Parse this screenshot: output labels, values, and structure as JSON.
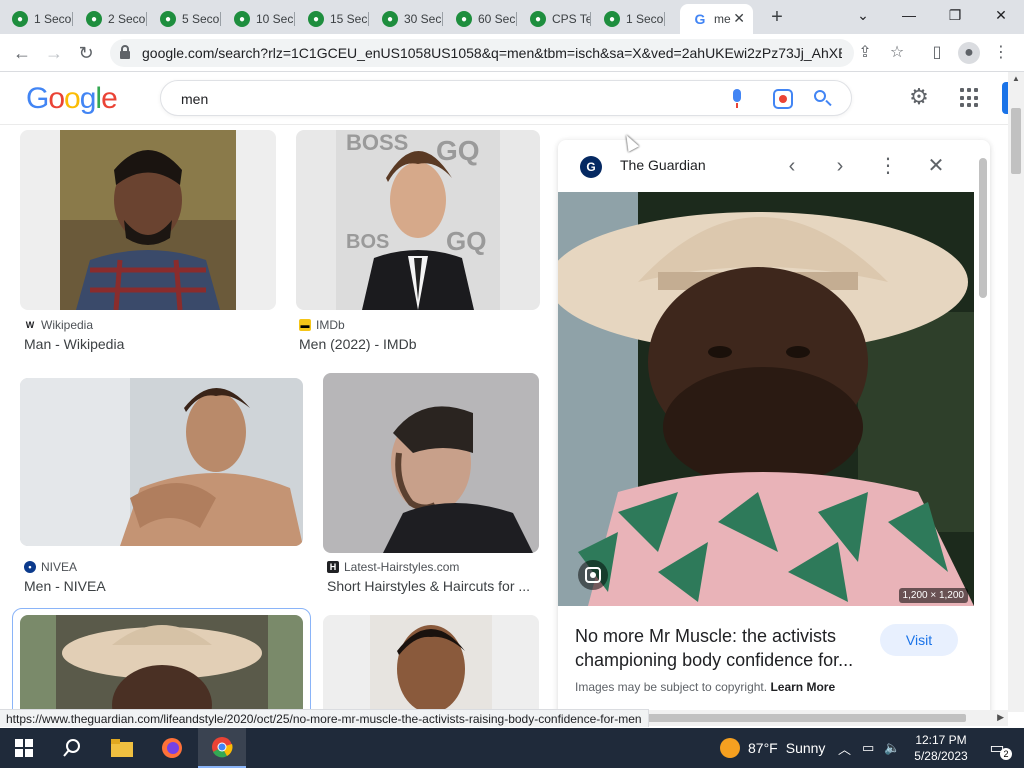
{
  "browser": {
    "tabs": [
      {
        "label": "1 Seco"
      },
      {
        "label": "2 Seco"
      },
      {
        "label": "5 Seco"
      },
      {
        "label": "10 Sec"
      },
      {
        "label": "15 Sec"
      },
      {
        "label": "30 Sec"
      },
      {
        "label": "60 Sec"
      },
      {
        "label": "CPS Te"
      },
      {
        "label": "1 Seco"
      },
      {
        "label": "me"
      }
    ],
    "url": "google.com/search?rlz=1C1GCEU_enUS1058US1058&q=men&tbm=isch&sa=X&ved=2ahUKEwi2zPz73Jj_AhXBl..."
  },
  "search": {
    "query": "men"
  },
  "results": [
    {
      "source": "Wikipedia",
      "title": "Man - Wikipedia"
    },
    {
      "source": "IMDb",
      "title": "Men (2022) - IMDb"
    },
    {
      "source": "NIVEA",
      "title": "Men - NIVEA"
    },
    {
      "source": "Latest-Hairstyles.com",
      "title": "Short Hairstyles & Haircuts for ..."
    }
  ],
  "preview": {
    "source": "The Guardian",
    "dimensions": "1,200 × 1,200",
    "title": "No more Mr Muscle: the activists championing body confidence for...",
    "visit_label": "Visit",
    "copyright_text": "Images may be subject to copyright.",
    "learn_more": "Learn More"
  },
  "status_url": "https://www.theguardian.com/lifeandstyle/2020/oct/25/no-more-mr-muscle-the-activists-raising-body-confidence-for-men",
  "taskbar": {
    "weather_temp": "87°F",
    "weather_desc": "Sunny",
    "time": "12:17 PM",
    "date": "5/28/2023",
    "notifications": "2"
  },
  "colors": {
    "accent": "#1a73e8",
    "tab_strip": "#dee1e6",
    "taskbar": "#1f2a3a"
  }
}
